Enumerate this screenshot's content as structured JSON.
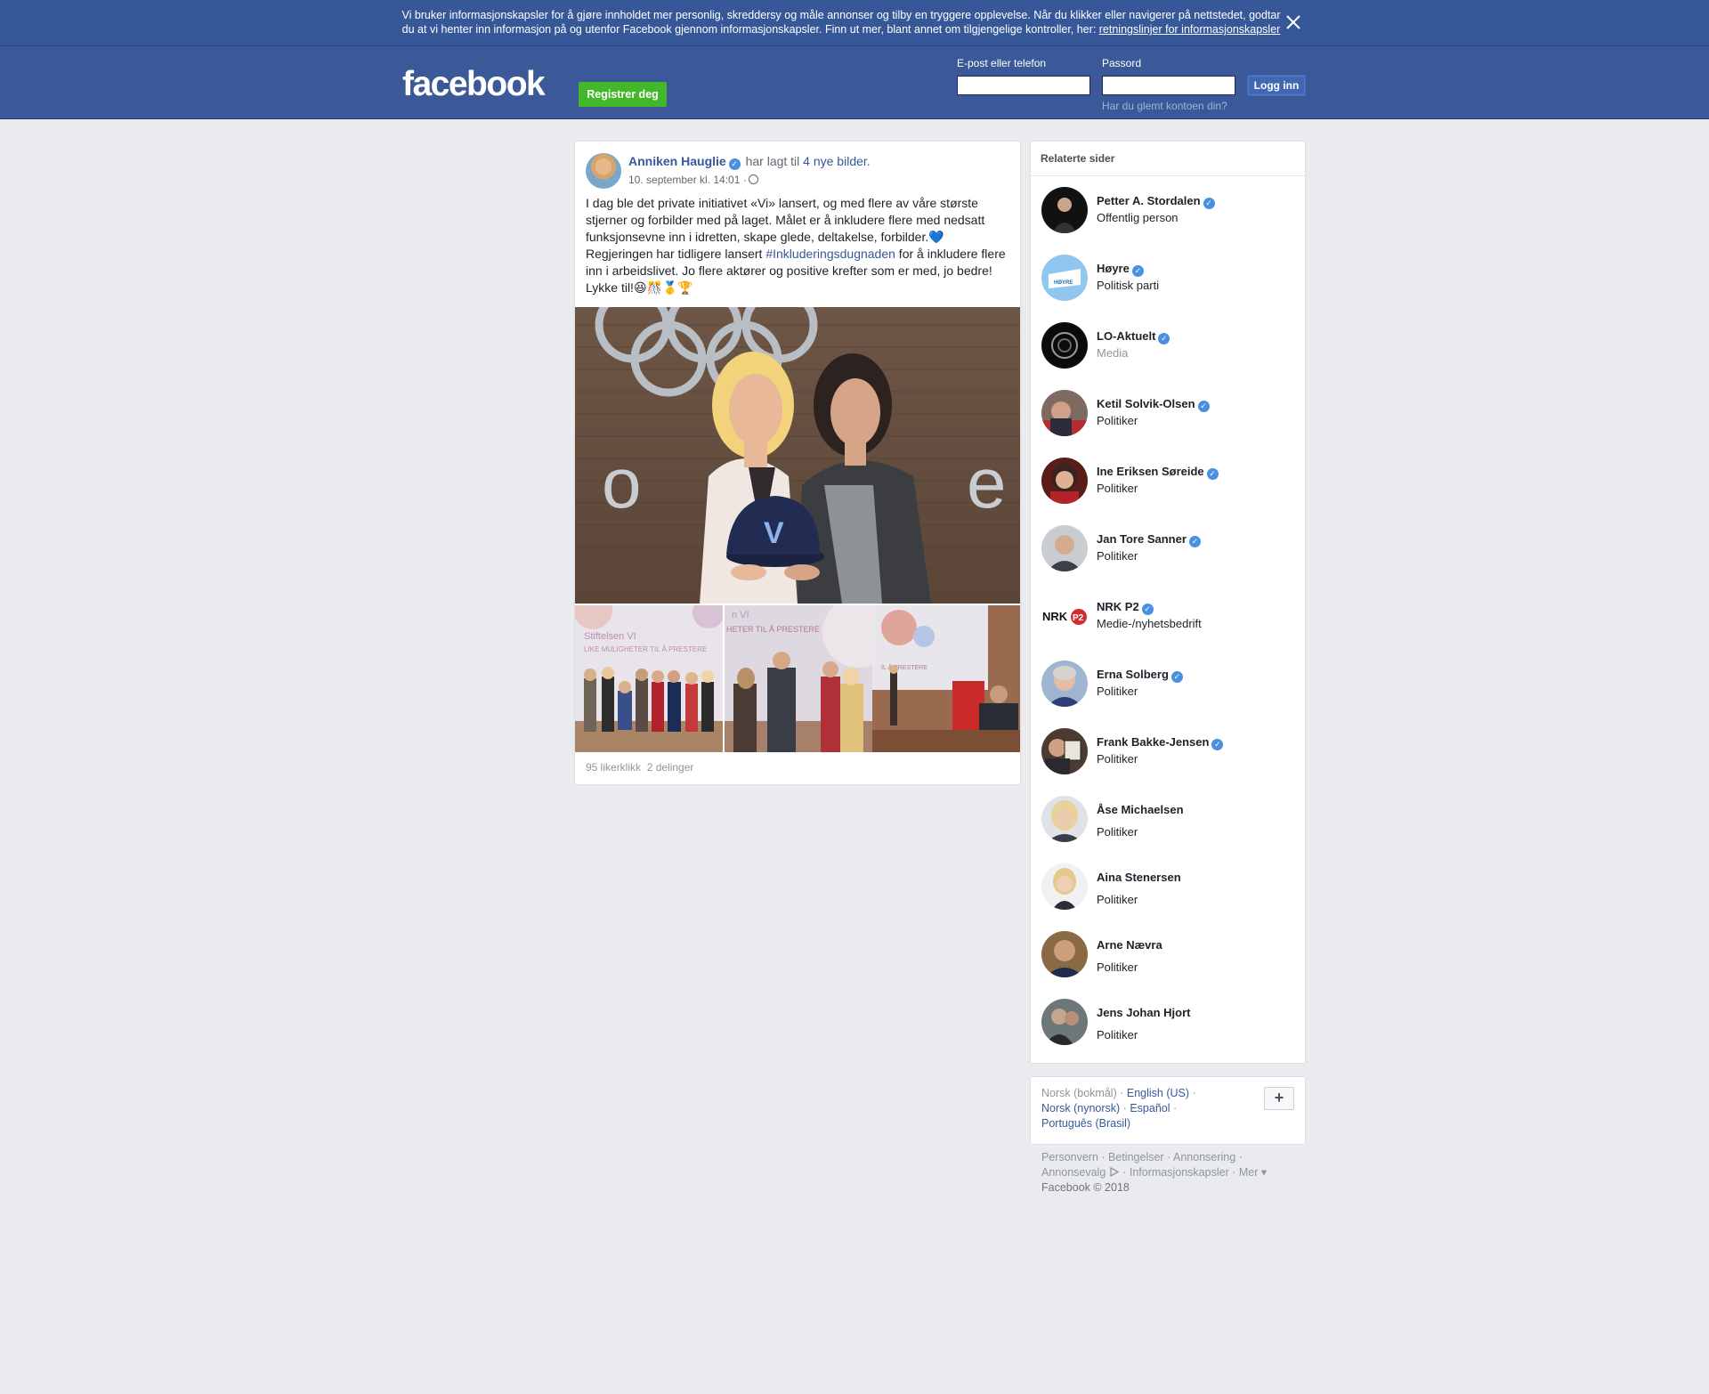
{
  "cookie_banner": {
    "text": "Vi bruker informasjonskapsler for å gjøre innholdet mer personlig, skreddersy og måle annonser og tilby en tryggere opplevelse. Når du klikker eller navigerer på nettstedet, godtar du at vi henter inn informasjon på og utenfor Facebook gjennom informasjonskapsler. Finn ut mer, blant annet om tilgjengelige kontroller, her: ",
    "link": "retningslinjer for informasjonskapsler",
    "close_icon": "close-icon"
  },
  "header": {
    "logo": "facebook",
    "register_label": "Registrer deg",
    "email_label": "E-post eller telefon",
    "password_label": "Passord",
    "login_label": "Logg inn",
    "forgot_label": "Har du glemt kontoen din?"
  },
  "post": {
    "author": "Anniken Hauglie",
    "action": "har lagt til",
    "action_link": "4 nye bilder.",
    "time": "10. september kl. 14:01 ·",
    "text_part1": "I dag ble det private initiativet «Vi» lansert, og med flere av våre største stjerner og forbilder med på laget. Målet er å inkludere flere med nedsatt funksjonsevne inn i idretten, skape glede, deltakelse, forbilder.💙",
    "text_part2": "Regjeringen har tidligere lansert ",
    "hashtag": "#Inkluderingsdugnaden",
    "text_part3": " for å inkludere flere inn i arbeidslivet. Jo flere aktører og positive krefter som er med, jo bedre! Lykke til!😆🎊🥇🏆",
    "likes": "95 likerklikk",
    "shares": "2 delinger",
    "photo_texts": {
      "cap_letter": "V",
      "thumb1_line1": "Stiftelsen VI",
      "thumb1_line2": "LIKE MULIGHETER TIL Å PRESTERE",
      "thumb2_line1": "n VI",
      "thumb2_line2": "HETER TIL Å PRESTERE",
      "thumb3_line": "IL Å PRESTERE"
    }
  },
  "related": {
    "title": "Relaterte sider",
    "items": [
      {
        "name": "Petter A. Stordalen",
        "category": "Offentlig person",
        "verified": true
      },
      {
        "name": "Høyre",
        "category": "Politisk parti",
        "verified": true
      },
      {
        "name": "LO-Aktuelt",
        "category": "Media",
        "verified": true
      },
      {
        "name": "Ketil Solvik-Olsen",
        "category": "Politiker",
        "verified": true
      },
      {
        "name": "Ine Eriksen Søreide",
        "category": "Politiker",
        "verified": true
      },
      {
        "name": "Jan Tore Sanner",
        "category": "Politiker",
        "verified": true
      },
      {
        "name": "NRK P2",
        "category": "Medie-/nyhetsbedrift",
        "verified": true
      },
      {
        "name": "Erna Solberg",
        "category": "Politiker",
        "verified": true
      },
      {
        "name": "Frank Bakke-Jensen",
        "category": "Politiker",
        "verified": true
      },
      {
        "name": "Åse Michaelsen",
        "category": "Politiker",
        "verified": false
      },
      {
        "name": "Aina Stenersen",
        "category": "Politiker",
        "verified": false
      },
      {
        "name": "Arne Nævra",
        "category": "Politiker",
        "verified": false
      },
      {
        "name": "Jens Johan Hjort",
        "category": "Politiker",
        "verified": false
      }
    ],
    "avatar_texts": {
      "hoyre": "HØYRE",
      "nrk": "NRK",
      "p2": "P2"
    }
  },
  "languages": {
    "current": "Norsk (bokmål)",
    "links": [
      "English (US)",
      "Norsk (nynorsk)",
      "Español",
      "Português (Brasil)"
    ],
    "plus": "+"
  },
  "footer": {
    "links": [
      "Personvern",
      "Betingelser",
      "Annonsering",
      "Annonsevalg",
      "Informasjonskapsler",
      "Mer"
    ],
    "copyright": "Facebook © 2018"
  },
  "colors": {
    "brand_blue": "#3b5998",
    "link_blue": "#365899",
    "register_green": "#42b72a",
    "page_bg": "#e9ebee"
  }
}
